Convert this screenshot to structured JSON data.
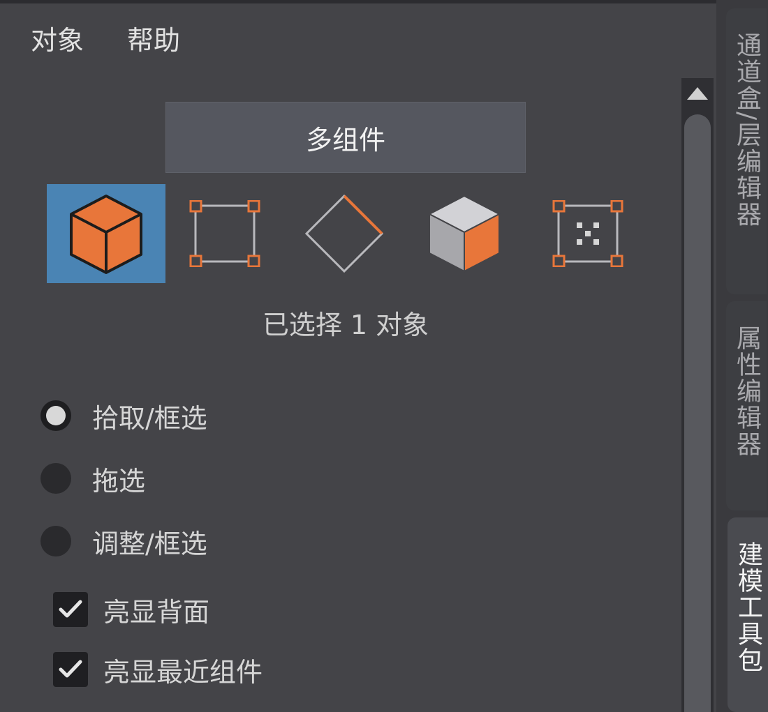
{
  "menu": {
    "items": [
      "对象",
      "帮助"
    ]
  },
  "panel": {
    "mode_button_label": "多组件",
    "selection_status": "已选择 1 对象",
    "selection_modes": [
      "object-mode",
      "vertex-mode",
      "edge-mode",
      "face-mode",
      "uv-mode"
    ],
    "active_mode": "object-mode",
    "radios": [
      {
        "label": "拾取/框选",
        "checked": true
      },
      {
        "label": "拖选",
        "checked": false
      },
      {
        "label": "调整/框选",
        "checked": false
      }
    ],
    "checkboxes": [
      {
        "label": "亮显背面",
        "checked": true
      },
      {
        "label": "亮显最近组件",
        "checked": true
      }
    ]
  },
  "dock_tabs": [
    {
      "label": "通道盒/层编辑器",
      "active": false
    },
    {
      "label": "属性编辑器",
      "active": false
    },
    {
      "label": "建模工具包",
      "active": true
    }
  ],
  "colors": {
    "accent_orange": "#e8763a",
    "active_blue": "#4a84b4",
    "panel_bg": "#444448"
  }
}
